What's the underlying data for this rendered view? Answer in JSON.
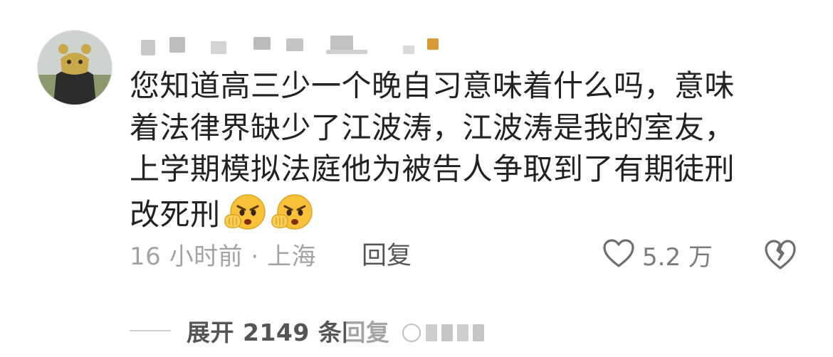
{
  "comment": {
    "text_lines": [
      "您知道高三少一个晚自习意味着什么吗，意味",
      "着法律界缺少了江波涛，江波涛是我的室友，",
      "上学期模拟法庭他为被告人争取到了有期徒刑",
      "改死刑"
    ],
    "emoji_names": [
      "angry-fist-emoji",
      "angry-fist-emoji"
    ],
    "time_location": "16 小时前 · 上海",
    "reply_label": "回复",
    "like_count": "5.2 万",
    "expand_label": "展开 2149 条回复"
  },
  "icons": {
    "like": "heart-outline-icon",
    "dislike": "broken-heart-icon"
  },
  "colors": {
    "text": "#222222",
    "meta": "#a3a3a3",
    "reply": "#555555",
    "emoji_face": "#f7c23a"
  }
}
